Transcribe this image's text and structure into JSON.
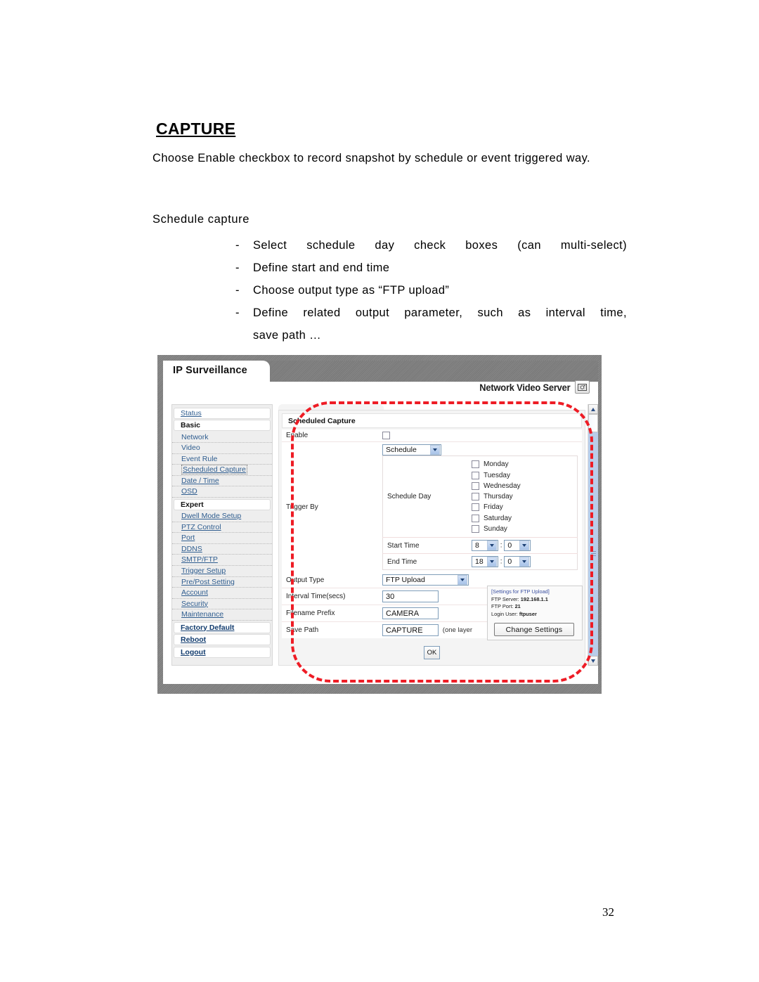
{
  "document": {
    "title": "CAPTURE",
    "paragraph": "Choose Enable checkbox to record snapshot by schedule or event triggered way.",
    "subhead": "Schedule capture",
    "bullets": [
      "Select schedule day check boxes (can multi-select)",
      "Define start and end time",
      "Choose output type as “FTP upload”",
      "Define related output parameter, such as interval time,",
      "save path …"
    ],
    "page_number": "32"
  },
  "screenshot": {
    "header": {
      "brand": "IP Surveillance",
      "model": "Network Video Server",
      "camera_icon": "camera-icon"
    },
    "sidebar": {
      "items": [
        {
          "label": "Status",
          "style": "top"
        },
        {
          "label": "Basic",
          "style": "group"
        },
        {
          "label": "Network",
          "style": "sub-plain"
        },
        {
          "label": "Video",
          "style": "sub-plain"
        },
        {
          "label": "Event Rule",
          "style": "sub-plain"
        },
        {
          "label": "Scheduled Capture",
          "style": "sub-current"
        },
        {
          "label": "Date / Time",
          "style": "sub"
        },
        {
          "label": "OSD",
          "style": "sub"
        },
        {
          "label": "Expert",
          "style": "group"
        },
        {
          "label": "Dwell Mode Setup",
          "style": "sub"
        },
        {
          "label": "PTZ Control",
          "style": "sub"
        },
        {
          "label": "Port",
          "style": "sub"
        },
        {
          "label": "DDNS",
          "style": "sub"
        },
        {
          "label": "SMTP/FTP",
          "style": "sub"
        },
        {
          "label": "Trigger Setup",
          "style": "sub"
        },
        {
          "label": "Pre/Post Setting",
          "style": "sub"
        },
        {
          "label": "Account",
          "style": "sub"
        },
        {
          "label": "Security",
          "style": "sub"
        },
        {
          "label": "Maintenance",
          "style": "sub"
        },
        {
          "label": "Factory Default",
          "style": "top-bold"
        },
        {
          "label": "Reboot",
          "style": "top-bold"
        },
        {
          "label": "Logout",
          "style": "top-bold"
        }
      ]
    },
    "panel": {
      "title": "Scheduled Capture",
      "enable_label": "Enable",
      "enable_checked": false,
      "trigger_by_label": "Trigger By",
      "trigger_mode": "Schedule",
      "schedule_day_label": "Schedule Day",
      "days": [
        {
          "label": "Monday",
          "checked": false
        },
        {
          "label": "Tuesday",
          "checked": false
        },
        {
          "label": "Wednesday",
          "checked": false
        },
        {
          "label": "Thursday",
          "checked": false
        },
        {
          "label": "Friday",
          "checked": false
        },
        {
          "label": "Saturday",
          "checked": false
        },
        {
          "label": "Sunday",
          "checked": false
        }
      ],
      "start_time_label": "Start Time",
      "start_hour": "8",
      "start_minute": "0",
      "end_time_label": "End Time",
      "end_hour": "18",
      "end_minute": "0",
      "time_separator": ":",
      "output_type_label": "Output Type",
      "output_type_value": "FTP Upload",
      "interval_label": "Interval Time(secs)",
      "interval_value": "30",
      "filename_prefix_label": "Filename Prefix",
      "filename_prefix_value": "CAMERA",
      "save_path_label": "Save Path",
      "save_path_value": "CAPTURE",
      "save_path_note": "(one layer",
      "ok_label": "OK"
    },
    "ftp_box": {
      "heading": "[Settings for FTP Upload]",
      "server_label": "FTP Server:",
      "server_value": "192.168.1.1",
      "port_label": "FTP Port:",
      "port_value": "21",
      "user_label": "Login User:",
      "user_value": "ftpuser",
      "change_button": "Change Settings"
    },
    "annotation": {
      "shape": "red-dashed-rounded-rectangle",
      "color": "#ee1c25"
    }
  }
}
